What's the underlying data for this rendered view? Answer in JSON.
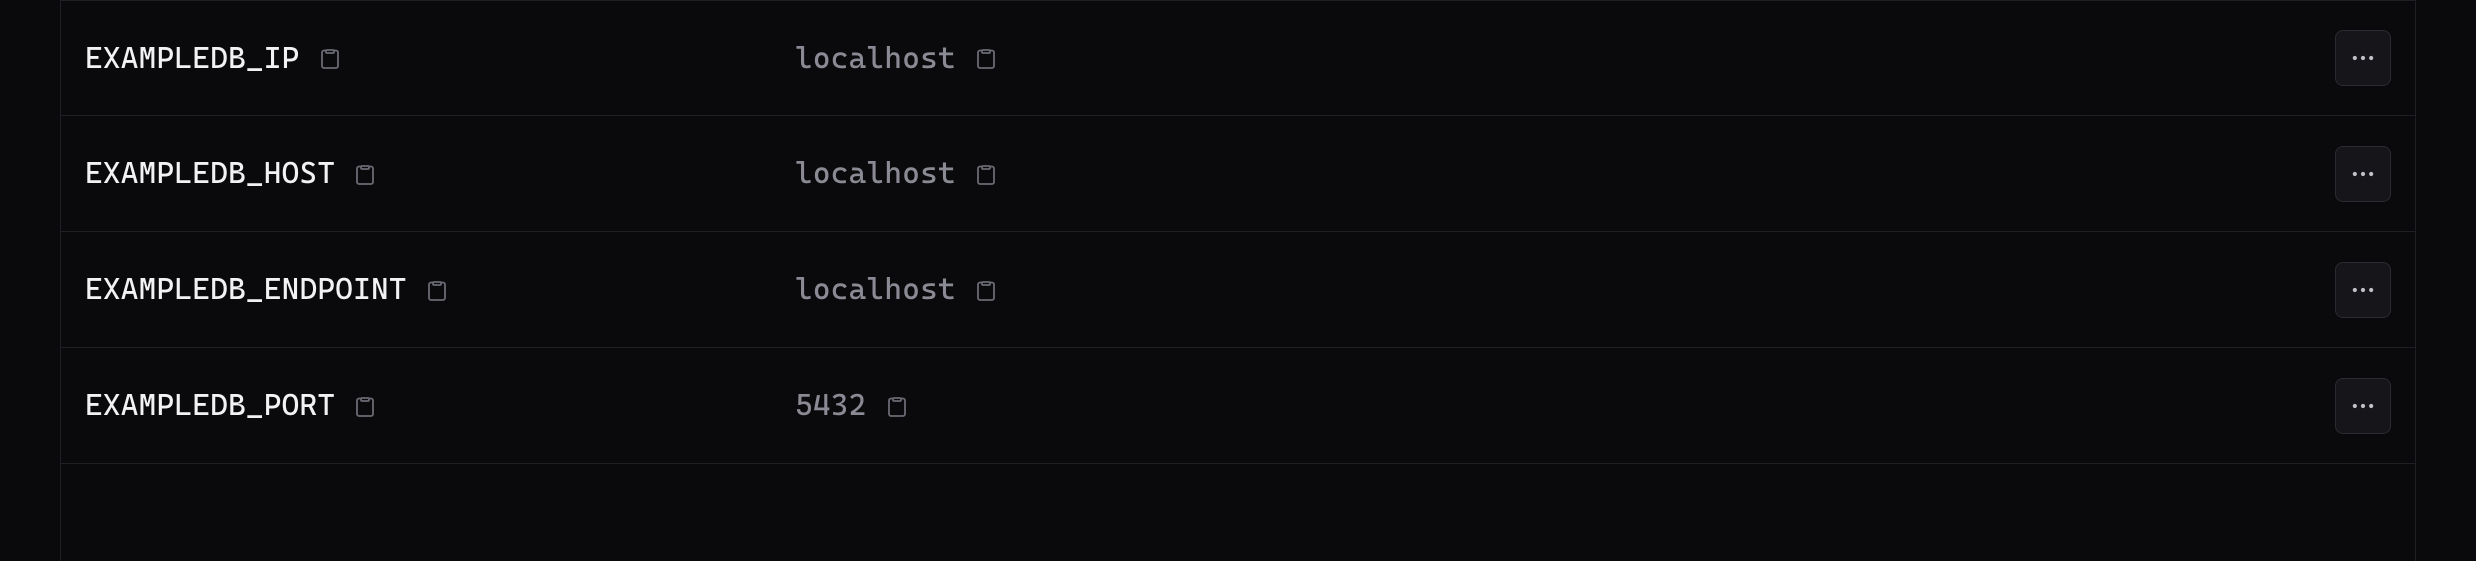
{
  "env_vars": [
    {
      "key": "EXAMPLEDB_IP",
      "value": "localhost"
    },
    {
      "key": "EXAMPLEDB_HOST",
      "value": "localhost"
    },
    {
      "key": "EXAMPLEDB_ENDPOINT",
      "value": "localhost"
    },
    {
      "key": "EXAMPLEDB_PORT",
      "value": "5432"
    }
  ]
}
